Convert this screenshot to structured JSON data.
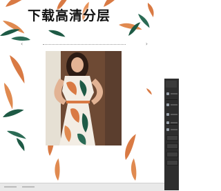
{
  "banner": {
    "title": "下载高清分层"
  },
  "toolbar": {
    "left_glyph": "‹",
    "right_glyph": "›"
  },
  "photo": {
    "description_icon": "product-photo"
  },
  "side_panel": {
    "items": 6
  },
  "colors": {
    "leaf_orange": "#d97a44",
    "leaf_green": "#1e5a45",
    "panel_dark": "#2e2e2e"
  }
}
